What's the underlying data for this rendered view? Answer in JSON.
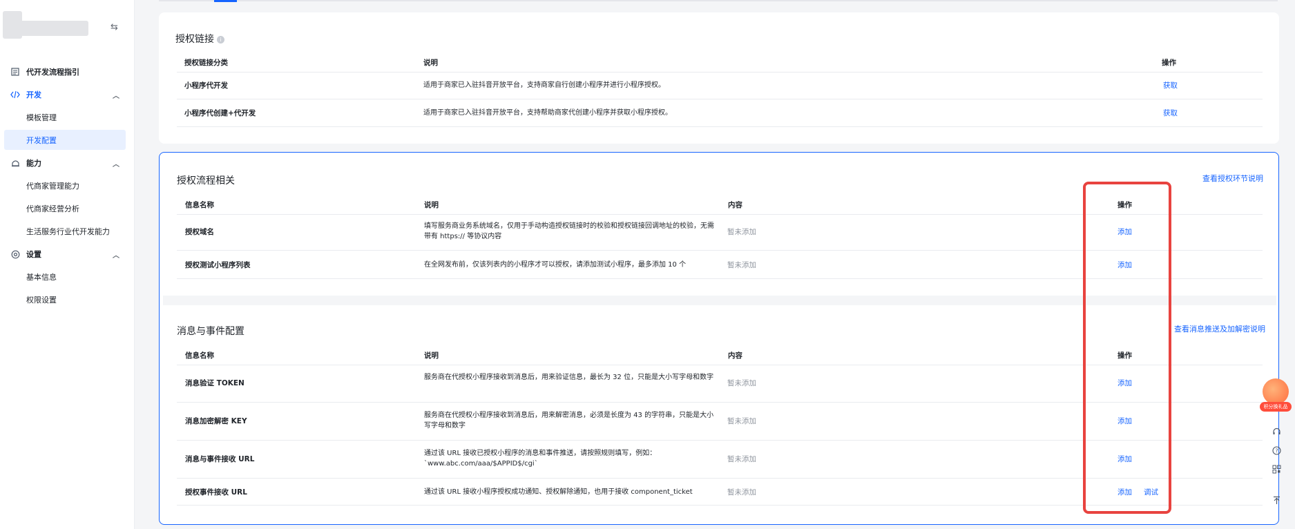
{
  "sidebar": {
    "collapse_icon": "⇆",
    "items": [
      {
        "label": "代开发流程指引",
        "icon": "document-icon"
      },
      {
        "label": "开发",
        "icon": "code-icon"
      },
      {
        "label": "模板管理"
      },
      {
        "label": "开发配置"
      },
      {
        "label": "能力",
        "icon": "ability-icon"
      },
      {
        "label": "代商家管理能力"
      },
      {
        "label": "代商家经营分析"
      },
      {
        "label": "生活服务行业代开发能力"
      },
      {
        "label": "设置",
        "icon": "settings-icon"
      },
      {
        "label": "基本信息"
      },
      {
        "label": "权限设置"
      }
    ]
  },
  "auth_link": {
    "title": "授权链接",
    "headers": {
      "type": "授权链接分类",
      "desc": "说明",
      "op": "操作"
    },
    "rows": [
      {
        "name": "小程序代开发",
        "desc": "适用于商家已入驻抖音开放平台，支持商家自行创建小程序并进行小程序授权。",
        "op": "获取"
      },
      {
        "name": "小程序代创建+代开发",
        "desc": "适用于商家已入驻抖音开放平台，支持帮助商家代创建小程序并获取小程序授权。",
        "op": "获取"
      }
    ]
  },
  "auth_flow": {
    "title": "授权流程相关",
    "link": "查看授权环节说明",
    "headers": {
      "name": "信息名称",
      "desc": "说明",
      "content": "内容",
      "op": "操作"
    },
    "rows": [
      {
        "name": "授权域名",
        "desc": "填写服务商业务系统域名，仅用于手动构造授权链接时的校验和授权链接回调地址的校验，无需带有 https:// 等协议内容",
        "content": "暂未添加",
        "op": "添加"
      },
      {
        "name": "授权测试小程序列表",
        "desc": "在全网发布前，仅该列表内的小程序才可以授权，请添加测试小程序，最多添加 10 个",
        "content": "暂未添加",
        "op": "添加"
      }
    ]
  },
  "msg_event": {
    "title": "消息与事件配置",
    "link": "查看消息推送及加解密说明",
    "headers": {
      "name": "信息名称",
      "desc": "说明",
      "content": "内容",
      "op": "操作"
    },
    "rows": [
      {
        "name": "消息验证 TOKEN",
        "desc": "服务商在代授权小程序接收到消息后，用来验证信息，最长为 32 位，只能是大小写字母和数字",
        "content": "暂未添加",
        "op": "添加"
      },
      {
        "name": "消息加密解密 KEY",
        "desc": "服务商在代授权小程序接收到消息后，用来解密消息，必须是长度为 43 的字符串，只能是大小写字母和数字",
        "content": "暂未添加",
        "op": "添加"
      },
      {
        "name": "消息与事件接收 URL",
        "desc": "通过该 URL 接收已授权小程序的消息和事件推送，请按照规则填写，例如：`www.abc.com/aaa/$APPID$/cgi`",
        "content": "暂未添加",
        "op": "添加"
      },
      {
        "name": "授权事件接收 URL",
        "desc": "通过该 URL 接收小程序授权成功通知、授权解除通知，也用于接收 component_ticket",
        "content": "暂未添加",
        "op": "添加",
        "op2": "调试"
      }
    ]
  },
  "float": {
    "gift_label": "积分换礼品",
    "tools": [
      "headset-icon",
      "help-icon",
      "qrcode-icon",
      "back-to-top-icon"
    ]
  },
  "colors": {
    "accent": "#1664ff",
    "highlight": "#e8433f"
  }
}
